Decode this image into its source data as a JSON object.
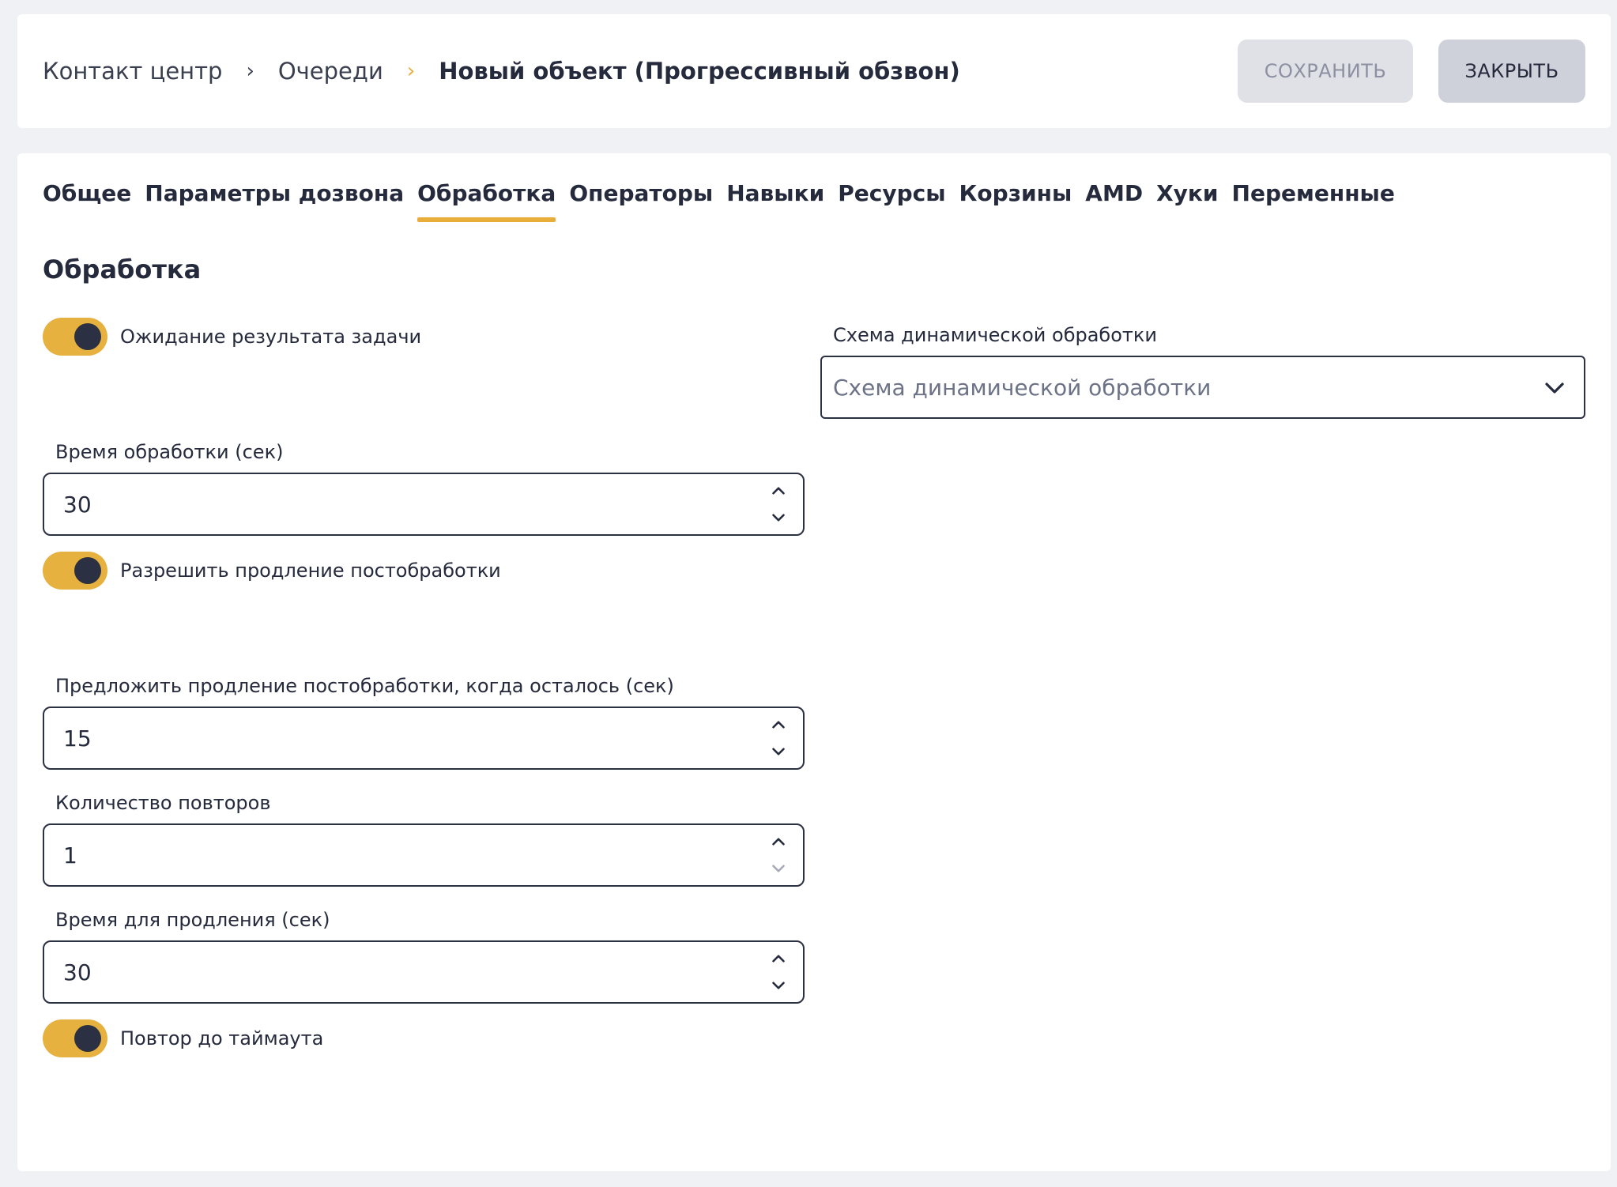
{
  "breadcrumb": {
    "items": [
      "Контакт центр",
      "Очереди"
    ],
    "current": "Новый объект (Прогрессивный обзвон)"
  },
  "header": {
    "save_label": "СОХРАНИТЬ",
    "close_label": "ЗАКРЫТЬ"
  },
  "tabs": [
    {
      "label": "Общее"
    },
    {
      "label": "Параметры дозвона"
    },
    {
      "label": "Обработка",
      "active": true
    },
    {
      "label": "Операторы"
    },
    {
      "label": "Навыки"
    },
    {
      "label": "Ресурсы"
    },
    {
      "label": "Корзины"
    },
    {
      "label": "AMD"
    },
    {
      "label": "Хуки"
    },
    {
      "label": "Переменные"
    }
  ],
  "section": {
    "title": "Обработка"
  },
  "form": {
    "wait_result": {
      "label": "Ожидание результата задачи",
      "on": true
    },
    "dynamic_scheme": {
      "label": "Схема динамической обработки",
      "placeholder": "Схема динамической обработки"
    },
    "processing_time": {
      "label": "Время обработки (сек)",
      "value": "30"
    },
    "allow_extension": {
      "label": "Разрешить продление постобработки",
      "on": true
    },
    "offer_extension": {
      "label": "Предложить продление постобработки, когда осталось (сек)",
      "value": "15"
    },
    "repeat_count": {
      "label": "Количество повторов",
      "value": "1"
    },
    "extension_time": {
      "label": "Время для продления (сек)",
      "value": "30"
    },
    "repeat_timeout": {
      "label": "Повтор до таймаута",
      "on": true
    }
  },
  "colors": {
    "accent": "#e9ad3a",
    "toggle_on": "#e6b13f",
    "text_dark": "#252a3c",
    "background": "#f0f1f5"
  }
}
